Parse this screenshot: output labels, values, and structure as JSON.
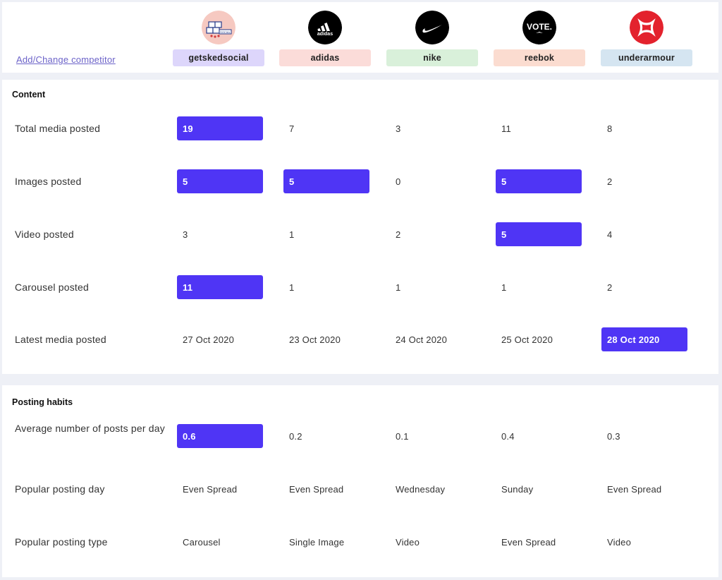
{
  "add_change_link": "Add/Change competitor",
  "competitors": [
    {
      "name": "getskedsocial",
      "chip_color": "#ddd6fb",
      "logo": "getskedsocial-logo",
      "logo_text": "SOCIAL"
    },
    {
      "name": "adidas",
      "chip_color": "#fbdcd9",
      "logo": "adidas-logo",
      "logo_text": "adidas"
    },
    {
      "name": "nike",
      "chip_color": "#d9f0da",
      "logo": "nike-logo",
      "logo_text": ""
    },
    {
      "name": "reebok",
      "chip_color": "#fbdcd0",
      "logo": "reebok-logo",
      "logo_text": "VOTE."
    },
    {
      "name": "underarmour",
      "chip_color": "#d5e5f1",
      "logo": "underarmour-logo",
      "logo_text": ""
    }
  ],
  "highlight_color": "#4f35f5",
  "content": {
    "title": "Content",
    "rows": [
      {
        "label": "Total media posted",
        "values": [
          "19",
          "7",
          "3",
          "11",
          "8"
        ],
        "highlight": [
          true,
          false,
          false,
          false,
          false
        ]
      },
      {
        "label": "Images posted",
        "values": [
          "5",
          "5",
          "0",
          "5",
          "2"
        ],
        "highlight": [
          true,
          true,
          false,
          true,
          false
        ]
      },
      {
        "label": "Video posted",
        "values": [
          "3",
          "1",
          "2",
          "5",
          "4"
        ],
        "highlight": [
          false,
          false,
          false,
          true,
          false
        ]
      },
      {
        "label": "Carousel posted",
        "values": [
          "11",
          "1",
          "1",
          "1",
          "2"
        ],
        "highlight": [
          true,
          false,
          false,
          false,
          false
        ]
      },
      {
        "label": "Latest media posted",
        "values": [
          "27 Oct 2020",
          "23 Oct 2020",
          "24 Oct 2020",
          "25 Oct 2020",
          "28 Oct 2020"
        ],
        "highlight": [
          false,
          false,
          false,
          false,
          true
        ]
      }
    ]
  },
  "posting_habits": {
    "title": "Posting habits",
    "rows": [
      {
        "label": "Average number of posts per day",
        "values": [
          "0.6",
          "0.2",
          "0.1",
          "0.4",
          "0.3"
        ],
        "highlight": [
          true,
          false,
          false,
          false,
          false
        ]
      },
      {
        "label": "Popular posting day",
        "values": [
          "Even Spread",
          "Even Spread",
          "Wednesday",
          "Sunday",
          "Even Spread"
        ],
        "highlight": [
          false,
          false,
          false,
          false,
          false
        ]
      },
      {
        "label": "Popular posting type",
        "values": [
          "Carousel",
          "Single Image",
          "Video",
          "Even Spread",
          "Video"
        ],
        "highlight": [
          false,
          false,
          false,
          false,
          false
        ]
      }
    ]
  }
}
